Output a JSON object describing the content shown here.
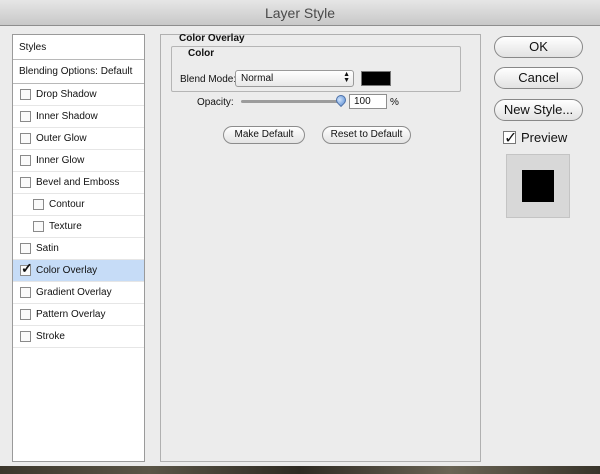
{
  "window": {
    "title": "Layer Style"
  },
  "styles_panel": {
    "header": "Styles",
    "blending_options": "Blending Options: Default",
    "items": [
      {
        "label": "Drop Shadow",
        "checked": false,
        "sub": false
      },
      {
        "label": "Inner Shadow",
        "checked": false,
        "sub": false
      },
      {
        "label": "Outer Glow",
        "checked": false,
        "sub": false
      },
      {
        "label": "Inner Glow",
        "checked": false,
        "sub": false
      },
      {
        "label": "Bevel and Emboss",
        "checked": false,
        "sub": false
      },
      {
        "label": "Contour",
        "checked": false,
        "sub": true
      },
      {
        "label": "Texture",
        "checked": false,
        "sub": true
      },
      {
        "label": "Satin",
        "checked": false,
        "sub": false
      },
      {
        "label": "Color Overlay",
        "checked": true,
        "sub": false,
        "selected": true
      },
      {
        "label": "Gradient Overlay",
        "checked": false,
        "sub": false
      },
      {
        "label": "Pattern Overlay",
        "checked": false,
        "sub": false
      },
      {
        "label": "Stroke",
        "checked": false,
        "sub": false
      }
    ]
  },
  "color_overlay": {
    "title": "Color Overlay",
    "group_title": "Color",
    "blend_mode_label": "Blend Mode:",
    "blend_mode_value": "Normal",
    "overlay_color": "#000000",
    "opacity_label": "Opacity:",
    "opacity_value": "100",
    "opacity_unit": "%",
    "opacity_level": 1.0,
    "make_default": "Make Default",
    "reset_default": "Reset to Default"
  },
  "buttons": {
    "ok": "OK",
    "cancel": "Cancel",
    "new_style": "New Style...",
    "preview_label": "Preview",
    "preview_checked": true
  },
  "colors": {
    "selected_row": "#c6dcf7",
    "slider_thumb": "#5c8fd6"
  },
  "icons": {
    "checkmark": "checkmark-icon",
    "select_arrows": "updown-arrows-icon",
    "slider_thumb": "slider-thumb-icon"
  }
}
